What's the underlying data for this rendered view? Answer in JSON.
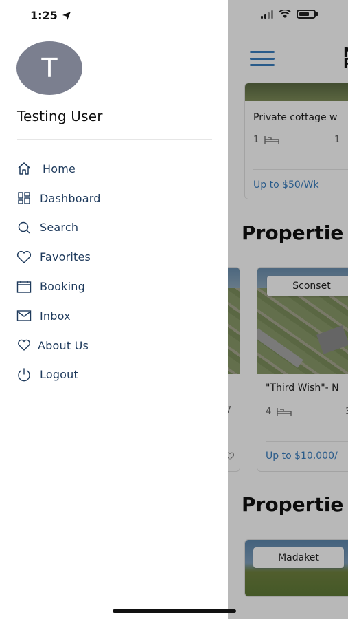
{
  "status_bar": {
    "time": "1:25"
  },
  "drawer": {
    "avatar_initial": "T",
    "user_name": "Testing User",
    "menu": [
      {
        "label": "Home",
        "icon": "home-icon"
      },
      {
        "label": "Dashboard",
        "icon": "dashboard-icon"
      },
      {
        "label": "Search",
        "icon": "search-icon"
      },
      {
        "label": "Favorites",
        "icon": "heart-icon"
      },
      {
        "label": "Booking",
        "icon": "calendar-icon"
      },
      {
        "label": "Inbox",
        "icon": "mail-icon"
      },
      {
        "label": "About Us",
        "icon": "heart-outline-icon"
      },
      {
        "label": "Logout",
        "icon": "power-icon"
      }
    ]
  },
  "background_app": {
    "logo_text": "N P",
    "listing_top": {
      "title": "Private cottage w",
      "beds": "1",
      "baths": "1",
      "price": "Up to $50/Wk"
    },
    "section_1_heading": "Propertie",
    "listing_left": {
      "meta": "7"
    },
    "listing_sconset": {
      "location_pill": "Sconset",
      "title": "\"Third Wish\"- N",
      "beds": "4",
      "baths": "3",
      "price": "Up to $10,000/"
    },
    "section_2_heading": "Propertie",
    "listing_madaket": {
      "location_pill": "Madaket"
    }
  },
  "colors": {
    "accent": "#3a7ec0",
    "menu_text": "#1e3a5c",
    "avatar_bg": "#7b7f8f"
  }
}
